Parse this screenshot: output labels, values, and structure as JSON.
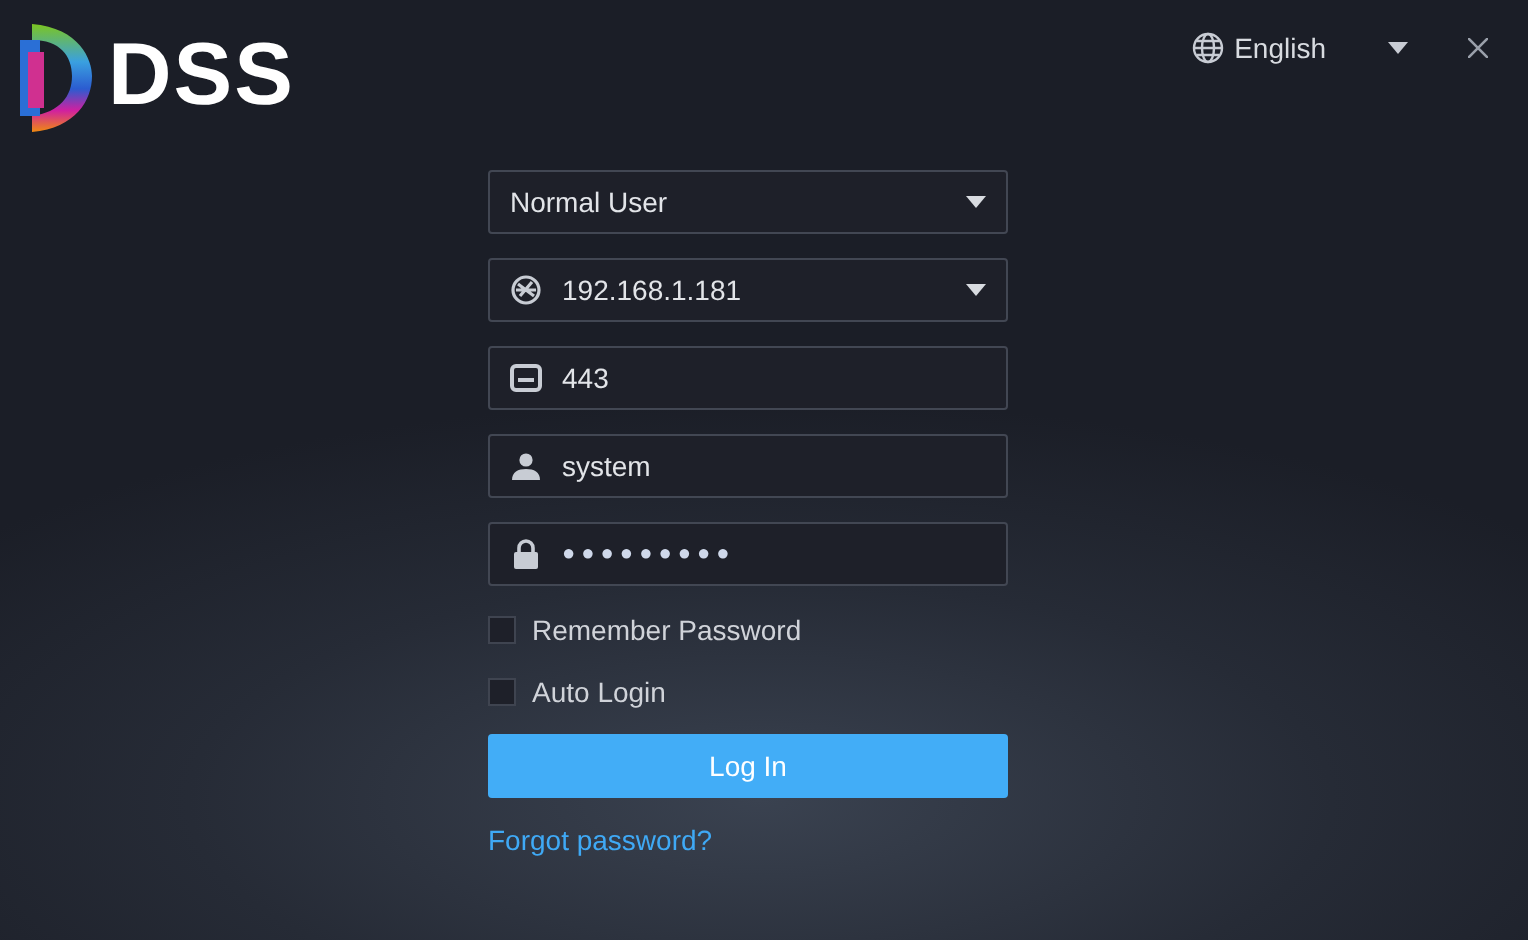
{
  "logo": {
    "text": "DSS"
  },
  "language": {
    "label": "English"
  },
  "fields": [
    {
      "kind": "role",
      "value": "Normal User"
    },
    {
      "kind": "server",
      "value": "192.168.1.181"
    },
    {
      "kind": "port",
      "value": "443"
    },
    {
      "kind": "username",
      "value": "system"
    },
    {
      "kind": "password",
      "value": "●●●●●●●●●"
    }
  ],
  "options": [
    {
      "label": "Remember Password",
      "checked": false
    },
    {
      "label": "Auto Login",
      "checked": false
    }
  ],
  "login_button": {
    "label": "Log In"
  },
  "forgot_link": {
    "label": "Forgot password?"
  }
}
